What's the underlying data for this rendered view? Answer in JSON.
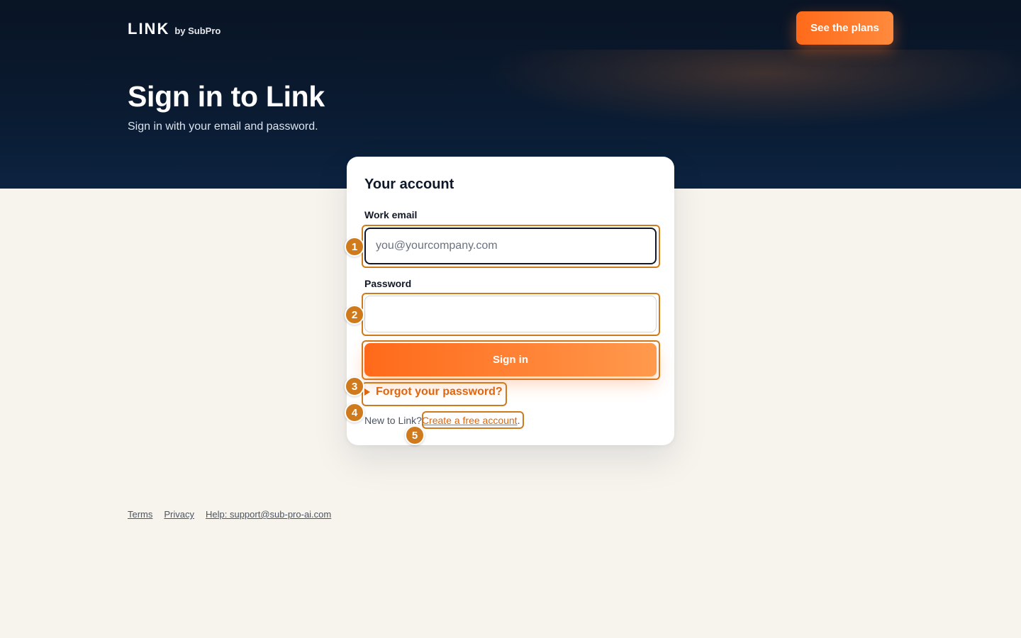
{
  "header": {
    "logo": "LINK",
    "logo_sub": "by SubPro",
    "plans_button": "See the plans",
    "title": "Sign in to Link",
    "subtitle": "Sign in with your email and password."
  },
  "form": {
    "card_title": "Your account",
    "email_label": "Work email",
    "email_placeholder": "you@yourcompany.com",
    "email_value": "",
    "password_label": "Password",
    "password_value": "",
    "signin_button": "Sign in",
    "forgot_password": "Forgot your password?",
    "new_prompt": "New to Link?",
    "create_account": "Create a free account",
    "create_suffix": "."
  },
  "badges": [
    "1",
    "2",
    "3",
    "4",
    "5"
  ],
  "footer": {
    "terms": "Terms",
    "privacy": "Privacy",
    "help": "Help: support@sub-pro-ai.com"
  },
  "colors": {
    "accent": "#ff6a1a",
    "hero_bg": "#0a1a30",
    "page_bg": "#f7f4ee",
    "highlight": "#cf7a1c"
  }
}
